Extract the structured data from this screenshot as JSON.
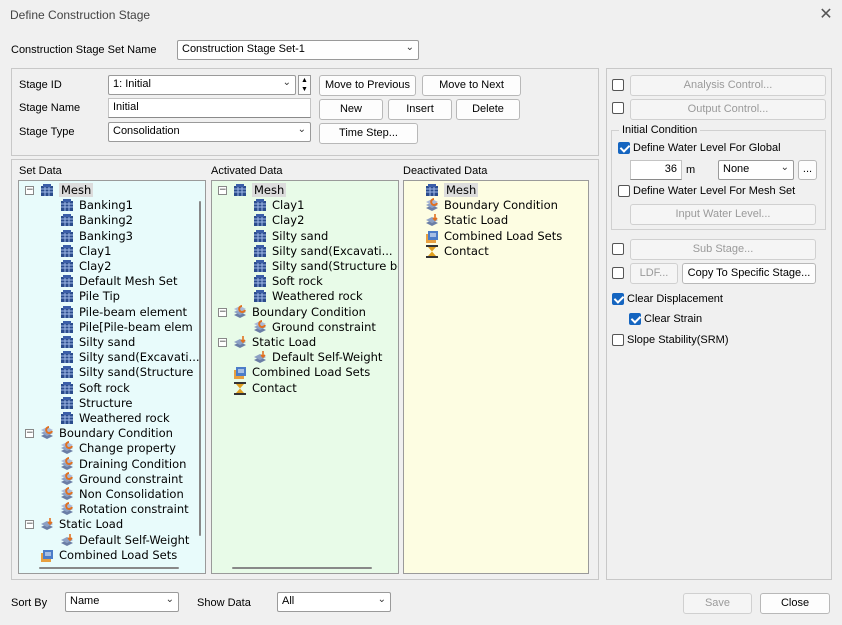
{
  "window": {
    "title": "Define Construction Stage",
    "close_glyph": "✕"
  },
  "stage_set": {
    "label": "Construction Stage Set Name",
    "value": "Construction Stage Set-1"
  },
  "stage": {
    "id_label": "Stage ID",
    "id_value": "1: Initial",
    "name_label": "Stage Name",
    "name_value": "Initial",
    "type_label": "Stage Type",
    "type_value": "Consolidation"
  },
  "buttons": {
    "move_prev": "Move to Previous",
    "move_next": "Move to Next",
    "new": "New",
    "insert": "Insert",
    "delete": "Delete",
    "time_step": "Time Step...",
    "save": "Save",
    "close": "Close"
  },
  "panels": {
    "set_data": "Set Data",
    "activated_data": "Activated Data",
    "deactivated_data": "Deactivated Data"
  },
  "set_tree": [
    {
      "label": "Mesh",
      "icon": "mesh-icon",
      "level": 0,
      "expander": "−",
      "selected": true
    },
    {
      "label": "Banking1",
      "icon": "mesh-icon",
      "level": 1
    },
    {
      "label": "Banking2",
      "icon": "mesh-icon",
      "level": 1
    },
    {
      "label": "Banking3",
      "icon": "mesh-icon",
      "level": 1
    },
    {
      "label": "Clay1",
      "icon": "mesh-icon",
      "level": 1
    },
    {
      "label": "Clay2",
      "icon": "mesh-icon",
      "level": 1
    },
    {
      "label": "Default Mesh Set",
      "icon": "mesh-icon",
      "level": 1
    },
    {
      "label": "Pile Tip",
      "icon": "mesh-icon",
      "level": 1
    },
    {
      "label": "Pile-beam element",
      "icon": "mesh-icon",
      "level": 1
    },
    {
      "label": "Pile[Pile-beam elem",
      "icon": "mesh-icon",
      "level": 1
    },
    {
      "label": "Silty sand",
      "icon": "mesh-icon",
      "level": 1
    },
    {
      "label": "Silty sand(Excavati...",
      "icon": "mesh-icon",
      "level": 1
    },
    {
      "label": "Silty sand(Structure",
      "icon": "mesh-icon",
      "level": 1
    },
    {
      "label": "Soft rock",
      "icon": "mesh-icon",
      "level": 1
    },
    {
      "label": "Structure",
      "icon": "mesh-icon",
      "level": 1
    },
    {
      "label": "Weathered rock",
      "icon": "mesh-icon",
      "level": 1
    },
    {
      "label": "Boundary Condition",
      "icon": "boundary-icon",
      "level": 0,
      "expander": "−"
    },
    {
      "label": "Change property",
      "icon": "boundary-icon",
      "level": 1
    },
    {
      "label": "Draining Condition",
      "icon": "boundary-icon",
      "level": 1
    },
    {
      "label": "Ground constraint",
      "icon": "boundary-icon",
      "level": 1
    },
    {
      "label": "Non Consolidation",
      "icon": "boundary-icon",
      "level": 1
    },
    {
      "label": "Rotation constraint",
      "icon": "boundary-icon",
      "level": 1
    },
    {
      "label": "Static Load",
      "icon": "load-icon",
      "level": 0,
      "expander": "−"
    },
    {
      "label": "Default Self-Weight",
      "icon": "load-icon",
      "level": 1
    },
    {
      "label": "Combined Load Sets",
      "icon": "combined-load-icon",
      "level": 0
    }
  ],
  "activated_tree": [
    {
      "label": "Mesh",
      "icon": "mesh-icon",
      "level": 0,
      "expander": "−",
      "selected": true
    },
    {
      "label": "Clay1",
      "icon": "mesh-icon",
      "level": 1
    },
    {
      "label": "Clay2",
      "icon": "mesh-icon",
      "level": 1
    },
    {
      "label": "Silty sand",
      "icon": "mesh-icon",
      "level": 1
    },
    {
      "label": "Silty sand(Excavati...",
      "icon": "mesh-icon",
      "level": 1
    },
    {
      "label": "Silty sand(Structure bo",
      "icon": "mesh-icon",
      "level": 1
    },
    {
      "label": "Soft rock",
      "icon": "mesh-icon",
      "level": 1
    },
    {
      "label": "Weathered rock",
      "icon": "mesh-icon",
      "level": 1
    },
    {
      "label": "Boundary Condition",
      "icon": "boundary-icon",
      "level": 0,
      "expander": "−"
    },
    {
      "label": "Ground constraint",
      "icon": "boundary-icon",
      "level": 1
    },
    {
      "label": "Static Load",
      "icon": "load-icon",
      "level": 0,
      "expander": "−"
    },
    {
      "label": "Default Self-Weight",
      "icon": "load-icon",
      "level": 1
    },
    {
      "label": "Combined Load Sets",
      "icon": "combined-load-icon",
      "level": 0
    },
    {
      "label": "Contact",
      "icon": "contact-icon",
      "level": 0
    }
  ],
  "deactivated_tree": [
    {
      "label": "Mesh",
      "icon": "mesh-icon",
      "level": 0,
      "selected": true
    },
    {
      "label": "Boundary Condition",
      "icon": "boundary-icon",
      "level": 0
    },
    {
      "label": "Static Load",
      "icon": "load-icon",
      "level": 0
    },
    {
      "label": "Combined Load Sets",
      "icon": "combined-load-icon",
      "level": 0
    },
    {
      "label": "Contact",
      "icon": "contact-icon",
      "level": 0
    }
  ],
  "right": {
    "analysis_control": "Analysis Control...",
    "output_control": "Output Control...",
    "initial_condition": "Initial Condition",
    "define_water_global": "Define Water Level For Global",
    "water_value": "36",
    "water_unit": "m",
    "water_combo": "None",
    "more_btn": "...",
    "define_water_mesh": "Define Water Level For Mesh Set",
    "input_water_level": "Input Water Level...",
    "sub_stage": "Sub Stage...",
    "ldf": "LDF...",
    "copy_specific": "Copy To Specific Stage...",
    "clear_displacement": "Clear Displacement",
    "clear_strain": "Clear Strain",
    "slope_stability": "Slope Stability(SRM)"
  },
  "footer": {
    "sort_by_label": "Sort By",
    "sort_by_value": "Name",
    "show_data_label": "Show Data",
    "show_data_value": "All"
  },
  "colors": {
    "set_bg": "#e8fbfb",
    "activated_bg": "#e8fbe8",
    "deactivated_bg": "#fdfde2",
    "check_blue": "#1565c0",
    "selected_bg": "#dcdcdc"
  }
}
